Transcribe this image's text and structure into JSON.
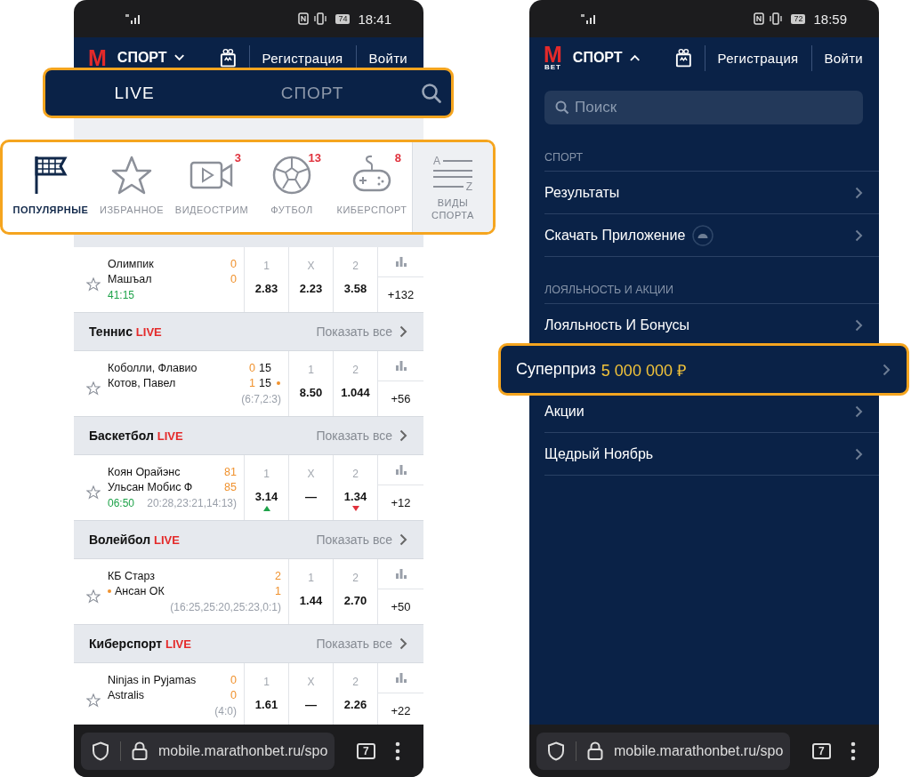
{
  "live_screen": {
    "status_bar": {
      "battery": "74",
      "time": "18:41"
    },
    "header": {
      "logo": {
        "letter": "M"
      },
      "section": "СПОРТ",
      "expanded": false,
      "links": [
        "Регистрация",
        "Войти"
      ]
    },
    "tabs": [
      {
        "label": "LIVE",
        "selected": true
      },
      {
        "label": "СПОРТ",
        "selected": false
      }
    ],
    "categories": [
      {
        "label": "ПОПУЛЯРНЫЕ",
        "selected": true
      },
      {
        "label": "ИЗБРАННОЕ",
        "selected": false
      },
      {
        "label": "ВИДЕОСТРИМ",
        "badge": "3",
        "selected": false
      },
      {
        "label": "ФУТБОЛ",
        "badge": "13",
        "selected": false
      },
      {
        "label": "КИБЕРСПОРТ",
        "badge": "8",
        "selected": false
      }
    ],
    "sports_list": {
      "label": "ВИДЫ СПОРТА",
      "icon_letters": [
        "A",
        "Z"
      ]
    },
    "feed": [
      {
        "kind": "match",
        "teams": [
          {
            "name": "Олимпик",
            "score": "0",
            "serving": false
          },
          {
            "name": "Машъал",
            "score": "0",
            "serving": false
          }
        ],
        "time": "41:15",
        "odds": [
          {
            "label": "1",
            "value": "2.83"
          },
          {
            "label": "X",
            "value": "2.23"
          },
          {
            "label": "2",
            "value": "3.58"
          }
        ],
        "more": "+132"
      },
      {
        "kind": "header",
        "sport": "Теннис",
        "live": "LIVE",
        "show_all": "Показать все"
      },
      {
        "kind": "match",
        "teams": [
          {
            "name": "Коболли, Флавио",
            "score": "0",
            "points": "15",
            "serving": false
          },
          {
            "name": "Котов, Павел",
            "score": "1",
            "points": "15",
            "serving": true
          }
        ],
        "extra": "(6:7,2:3)",
        "odds": [
          {
            "label": "1",
            "value": "8.50"
          },
          {
            "label": "2",
            "value": "1.044"
          }
        ],
        "more": "+56"
      },
      {
        "kind": "header",
        "sport": "Баскетбол",
        "live": "LIVE",
        "show_all": "Показать все"
      },
      {
        "kind": "match",
        "teams": [
          {
            "name": "Коян Орайэнс",
            "score": "81",
            "serving": false
          },
          {
            "name": "Ульсан Мобис Ф",
            "score": "85",
            "serving": false
          }
        ],
        "time": "06:50",
        "extra": "20:28,23:21,14:13)",
        "odds": [
          {
            "label": "1",
            "value": "3.14",
            "rising": true,
            "falling": false
          },
          {
            "label": "X",
            "value": "—",
            "rising": false,
            "falling": false
          },
          {
            "label": "2",
            "value": "1.34",
            "rising": false,
            "falling": true
          }
        ],
        "more": "+12"
      },
      {
        "kind": "header",
        "sport": "Волейбол",
        "live": "LIVE",
        "show_all": "Показать все"
      },
      {
        "kind": "match",
        "teams": [
          {
            "name": "КБ Старз",
            "score": "2",
            "serving": false
          },
          {
            "name": "Ансан ОК",
            "score": "1",
            "serving": true
          }
        ],
        "extra": "(16:25,25:20,25:23,0:1)",
        "odds": [
          {
            "label": "1",
            "value": "1.44"
          },
          {
            "label": "2",
            "value": "2.70"
          }
        ],
        "more": "+50"
      },
      {
        "kind": "header",
        "sport": "Киберспорт",
        "live": "LIVE",
        "show_all": "Показать все"
      },
      {
        "kind": "match",
        "teams": [
          {
            "name": "Ninjas in Pyjamas",
            "score": "0",
            "serving": false
          },
          {
            "name": "Astralis",
            "score": "0",
            "serving": false
          }
        ],
        "extra": "(4:0)",
        "odds": [
          {
            "label": "1",
            "value": "1.61"
          },
          {
            "label": "X",
            "value": "—"
          },
          {
            "label": "2",
            "value": "2.26"
          }
        ],
        "more": "+22"
      }
    ],
    "browser_bar": {
      "url": "mobile.marathonbet.ru/spo",
      "tab_count": "7"
    }
  },
  "menu_screen": {
    "status_bar": {
      "battery": "72",
      "time": "18:59"
    },
    "header": {
      "logo": {
        "letter": "M",
        "sub": "BET"
      },
      "section": "СПОРТ",
      "expanded": true,
      "links": [
        "Регистрация",
        "Войти"
      ]
    },
    "search": {
      "placeholder": "Поиск"
    },
    "menu": [
      {
        "kind": "section",
        "label": "СПОРТ"
      },
      {
        "kind": "item",
        "label": "Результаты"
      },
      {
        "kind": "app",
        "label": "Скачать Приложение"
      },
      {
        "kind": "section",
        "label": "ЛОЯЛЬНОСТЬ И АКЦИИ"
      },
      {
        "kind": "item",
        "label": "Лояльность И Бонусы"
      },
      {
        "kind": "callout",
        "label": "Суперприз",
        "amount": "5 000 000 ₽"
      },
      {
        "kind": "item",
        "label": "Акции"
      },
      {
        "kind": "item",
        "label": "Щедрый Ноябрь"
      }
    ],
    "browser_bar": {
      "url": "mobile.marathonbet.ru/spo",
      "tab_count": "7"
    }
  }
}
